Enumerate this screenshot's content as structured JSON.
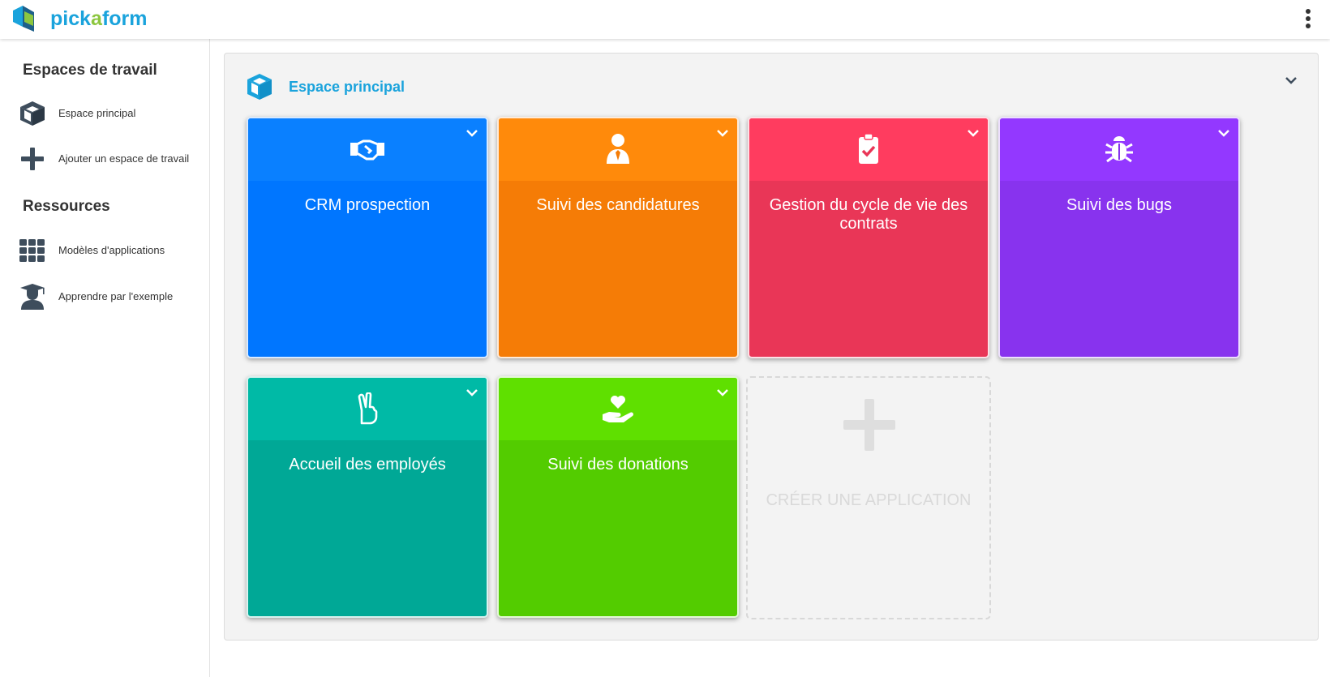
{
  "header": {
    "brand_part1": "pick",
    "brand_part2": "a",
    "brand_part3": "form",
    "menu_icon": "kebab-menu-icon"
  },
  "sidebar": {
    "workspaces_title": "Espaces de travail",
    "workspace_items": [
      {
        "label": "Espace principal",
        "icon": "cube-icon"
      },
      {
        "label": "Ajouter un espace de travail",
        "icon": "plus-icon"
      }
    ],
    "resources_title": "Ressources",
    "resource_items": [
      {
        "label": "Modèles d'applications",
        "icon": "grid-icon"
      },
      {
        "label": "Apprendre par l'exemple",
        "icon": "graduate-icon"
      }
    ]
  },
  "workspace": {
    "title": "Espace principal",
    "apps": [
      {
        "title": "CRM prospection",
        "icon": "handshake-icon",
        "color": "#0076ff",
        "head_color": "#0a7fff"
      },
      {
        "title": "Suivi des candidatures",
        "icon": "user-tie-icon",
        "color": "#f57c06",
        "head_color": "#ff8a0b"
      },
      {
        "title": "Gestion du cycle de vie des contrats",
        "icon": "clipboard-check-icon",
        "color": "#e93657",
        "head_color": "#ff3c5f"
      },
      {
        "title": "Suivi des bugs",
        "icon": "bug-icon",
        "color": "#8833ee",
        "head_color": "#9338ff"
      },
      {
        "title": "Accueil des employés",
        "icon": "hand-peace-icon",
        "color": "#00a896",
        "head_color": "#00baa6"
      },
      {
        "title": "Suivi des donations",
        "icon": "hand-holding-heart-icon",
        "color": "#53cc00",
        "head_color": "#5fe000"
      }
    ],
    "create_label": "CRÉER UNE APPLICATION"
  }
}
